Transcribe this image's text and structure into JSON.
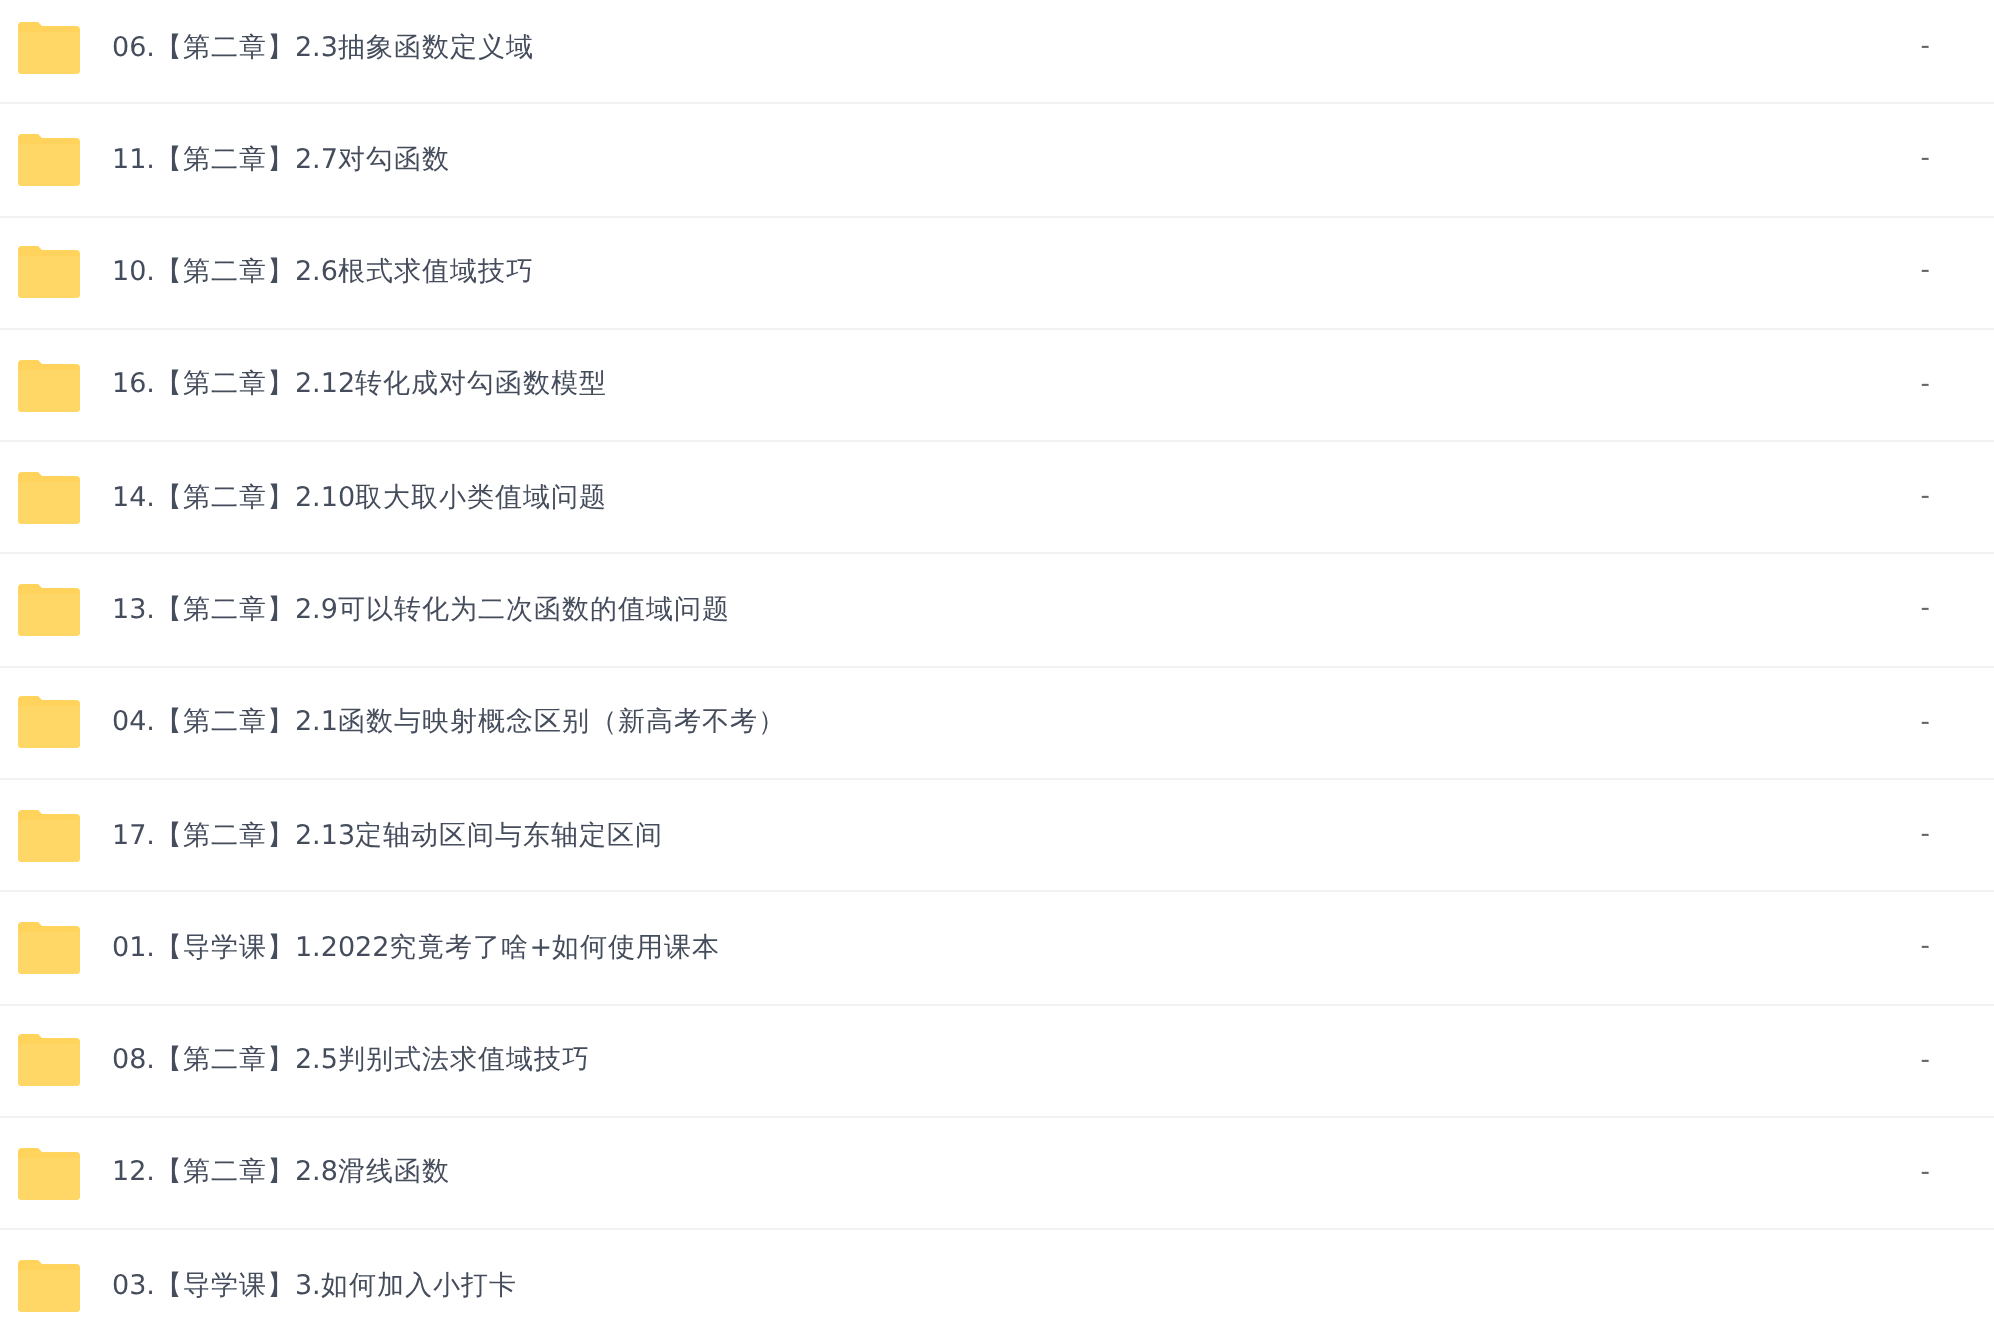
{
  "files": [
    {
      "name": "06.【第二章】2.3抽象函数定义域",
      "size": "-"
    },
    {
      "name": "11.【第二章】2.7对勾函数",
      "size": "-"
    },
    {
      "name": "10.【第二章】2.6根式求值域技巧",
      "size": "-"
    },
    {
      "name": "16.【第二章】2.12转化成对勾函数模型",
      "size": "-"
    },
    {
      "name": "14.【第二章】2.10取大取小类值域问题",
      "size": "-"
    },
    {
      "name": "13.【第二章】2.9可以转化为二次函数的值域问题",
      "size": "-"
    },
    {
      "name": "04.【第二章】2.1函数与映射概念区别（新高考不考）",
      "size": "-"
    },
    {
      "name": "17.【第二章】2.13定轴动区间与东轴定区间",
      "size": "-"
    },
    {
      "name": "01.【导学课】1.2022究竟考了啥+如何使用课本",
      "size": "-"
    },
    {
      "name": "08.【第二章】2.5判别式法求值域技巧",
      "size": "-"
    },
    {
      "name": "12.【第二章】2.8滑线函数",
      "size": "-"
    },
    {
      "name": "03.【导学课】3.如何加入小打卡"
    }
  ]
}
